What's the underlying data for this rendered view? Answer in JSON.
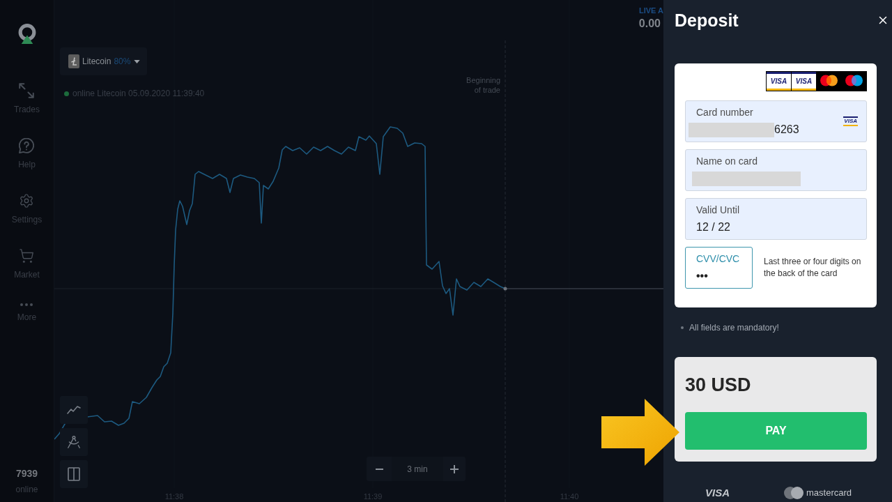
{
  "sidebar": {
    "items": [
      {
        "label": "Trades"
      },
      {
        "label": "Help"
      },
      {
        "label": "Settings"
      },
      {
        "label": "Market"
      },
      {
        "label": "More"
      }
    ],
    "online_count": "7939",
    "online_label": "online"
  },
  "chart": {
    "asset": {
      "name": "Litecoin",
      "payout": "80%"
    },
    "status": "online Litecoin 05.09.2020 11:39:40",
    "trade_marker": "Beginning of trade",
    "time_labels": [
      "11:38",
      "11:39",
      "11:40"
    ],
    "timeframe": "3 min"
  },
  "account": {
    "label": "LIVE A",
    "balance": "0.00"
  },
  "deposit": {
    "title": "Deposit",
    "accepted_cards": [
      {
        "kind": "visa",
        "label": "VISA"
      },
      {
        "kind": "visa",
        "label": "VISA"
      },
      {
        "kind": "mastercard"
      },
      {
        "kind": "maestro"
      }
    ],
    "fields": [
      {
        "label": "Card number",
        "value": "6263",
        "redacted": true,
        "brand": "VISA",
        "focused": false
      },
      {
        "label": "Name on card",
        "redacted": true,
        "focused": false
      },
      {
        "label": "Valid Until",
        "value": "12 / 22",
        "focused": false
      },
      {
        "label": "CVV/CVC",
        "value": "•••",
        "focused": true,
        "hint": "Last three or four digits on the back of the card"
      }
    ],
    "note": "All fields are mandatory!",
    "amount": "30 USD",
    "pay_button": "PAY",
    "footer_logos": [
      {
        "kind": "visa",
        "label": "VISA"
      },
      {
        "kind": "mastercard",
        "label": "mastercard"
      }
    ]
  }
}
